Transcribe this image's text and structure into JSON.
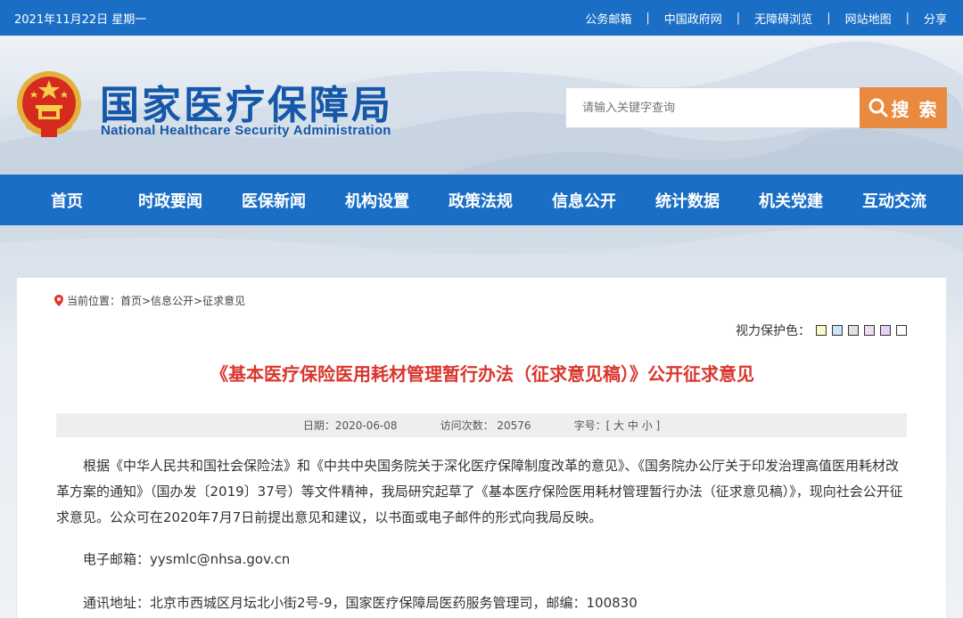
{
  "topbar": {
    "date": "2021年11月22日 星期一",
    "links": [
      "公务邮箱",
      "中国政府网",
      "无障碍浏览",
      "网站地图",
      "分享"
    ],
    "separator": "|"
  },
  "header": {
    "logo_cn": "国家医疗保障局",
    "logo_en": "National Healthcare Security Administration",
    "search_placeholder": "请输入关键字查询",
    "search_button": "搜 索"
  },
  "nav": {
    "items": [
      "首页",
      "时政要闻",
      "医保新闻",
      "机构设置",
      "政策法规",
      "信息公开",
      "统计数据",
      "机关党建",
      "互动交流"
    ]
  },
  "article": {
    "breadcrumb": "当前位置：首页>信息公开>征求意见",
    "eye_label": "视力保护色：",
    "swatches": [
      "#fafac8",
      "#c8e6fa",
      "#e1e1e1",
      "#f0dcf0",
      "#e8d2f5",
      "#ffffff"
    ],
    "title": "《基本医疗保险医用耗材管理暂行办法（征求意见稿）》公开征求意见",
    "meta_date": "日期：2020-06-08",
    "meta_visits": "访问次数：  20576",
    "meta_font": "字号：[ 大 中 小 ]",
    "paragraph": "根据《中华人民共和国社会保险法》和《中共中央国务院关于深化医疗保障制度改革的意见》、《国务院办公厅关于印发治理高值医用耗材改革方案的通知》（国办发〔2019〕37号）等文件精神，我局研究起草了《基本医疗保险医用耗材管理暂行办法（征求意见稿）》，现向社会公开征求意见。公众可在2020年7月7日前提出意见和建议，以书面或电子邮件的形式向我局反映。",
    "email_line": "电子邮箱：yysmlc@nhsa.gov.cn",
    "address_line": "通讯地址：北京市西城区月坛北小街2号-9，国家医疗保障局医药服务管理司，邮编：100830"
  },
  "colors": {
    "brand_blue": "#1a6ec5",
    "title_red": "#d9362c",
    "search_orange": "#e98a3f"
  }
}
